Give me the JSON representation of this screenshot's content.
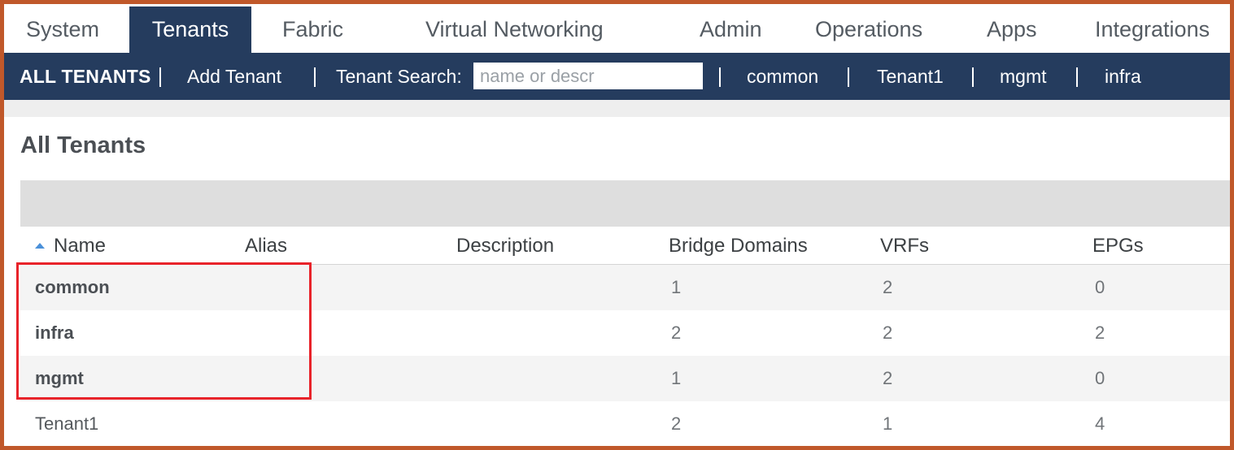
{
  "top_tabs": [
    "System",
    "Tenants",
    "Fabric",
    "Virtual Networking",
    "Admin",
    "Operations",
    "Apps",
    "Integrations"
  ],
  "active_tab": "Tenants",
  "subnav": {
    "all_tenants": "ALL TENANTS",
    "add_tenant": "Add Tenant",
    "search_label": "Tenant Search:",
    "search_placeholder": "name or descr",
    "quick_links": [
      "common",
      "Tenant1",
      "mgmt",
      "infra"
    ]
  },
  "page_title": "All Tenants",
  "table": {
    "columns": [
      "Name",
      "Alias",
      "Description",
      "Bridge Domains",
      "VRFs",
      "EPGs"
    ],
    "rows": [
      {
        "name": "common",
        "alias": "",
        "description": "",
        "bridge_domains": "1",
        "vrfs": "2",
        "epgs": "0"
      },
      {
        "name": "infra",
        "alias": "",
        "description": "",
        "bridge_domains": "2",
        "vrfs": "2",
        "epgs": "2"
      },
      {
        "name": "mgmt",
        "alias": "",
        "description": "",
        "bridge_domains": "1",
        "vrfs": "2",
        "epgs": "0"
      },
      {
        "name": "Tenant1",
        "alias": "",
        "description": "",
        "bridge_domains": "2",
        "vrfs": "1",
        "epgs": "4"
      }
    ]
  },
  "colors": {
    "nav_bg": "#253c5e",
    "highlight": "#e8232a",
    "frame": "#c0582a",
    "sort_icon": "#4a90d9"
  }
}
